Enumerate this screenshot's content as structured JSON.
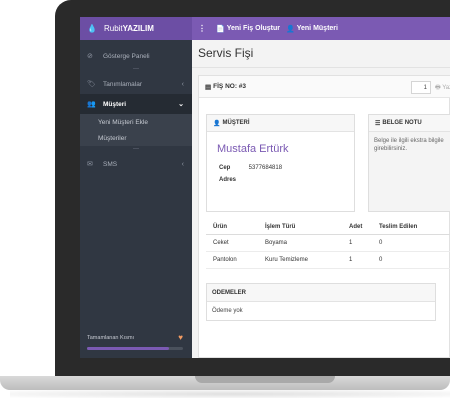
{
  "topbar": {
    "brand_prefix": "Rubit",
    "brand_strong": "YAZILIM",
    "toggle_icon": "⋮",
    "links": [
      {
        "icon": "📄",
        "label": "Yeni Fiş Oluştur"
      },
      {
        "icon": "👤",
        "label": "Yeni Müşteri"
      }
    ]
  },
  "sidebar": {
    "items": [
      {
        "icon": "⊘",
        "label": "Gösterge Paneli"
      },
      {
        "icon": "🏷",
        "label": "Tanımlamalar",
        "chevron": "‹"
      },
      {
        "icon": "👥",
        "label": "Müşteri",
        "chevron": "⌄"
      },
      {
        "icon": "✉",
        "label": "SMS",
        "chevron": "‹"
      }
    ],
    "sub_items": [
      {
        "label": "Yeni Müşteri Ekle"
      },
      {
        "label": "Müşteriler"
      }
    ],
    "bottom_label": "Tamamlanan Kısmı",
    "heart_icon": "♥",
    "progress": 0.85
  },
  "main": {
    "title": "Servis Fişi",
    "receipt_label": "FİŞ NO: #3",
    "receipt_icon": "▤",
    "quantity": "1",
    "print_label": "🖶 Yaz",
    "customer": {
      "head_icon": "👤",
      "head": "MÜŞTERİ",
      "name": "Mustafa Ertürk",
      "rows": [
        {
          "key": "Cep",
          "value": "5377684818"
        },
        {
          "key": "Adres",
          "value": ""
        }
      ]
    },
    "note": {
      "head_icon": "☰",
      "head": "BELGE NOTU",
      "line1": "Belge ile ilgili ekstra bilgile",
      "line2": "girebilirsiniz."
    },
    "table": {
      "headers": [
        "Ürün",
        "İşlem Türü",
        "Adet",
        "Teslim Edilen"
      ],
      "rows": [
        [
          "Ceket",
          "Boyama",
          "1",
          "0"
        ],
        [
          "Pantolon",
          "Kuru Temizleme",
          "1",
          "0"
        ]
      ]
    },
    "payments": {
      "head": "ODEMELER",
      "empty": "Ödeme yok"
    }
  },
  "colors": {
    "accent": "#7b5ab3",
    "sidebar_bg": "#303742",
    "heart": "#f29b62"
  }
}
